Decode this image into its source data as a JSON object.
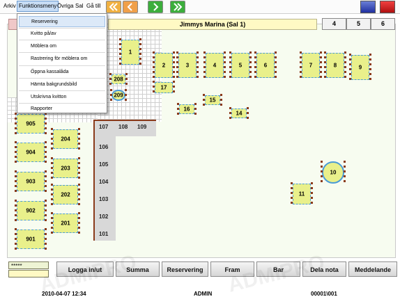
{
  "menubar": {
    "items": [
      "Arkiv",
      "Funktionsmeny",
      "Övriga",
      "Sal",
      "Gå till"
    ]
  },
  "nav": {
    "buttons": [
      "double-left-arrow-icon",
      "left-arrow-icon",
      "right-arrow-icon",
      "double-right-arrow-icon"
    ],
    "colors": [
      "#f0b040",
      "#f0a04a",
      "#3cae3c",
      "#3cae3c"
    ]
  },
  "window": {
    "buttons": [
      "blue-square-icon",
      "red-square-icon"
    ]
  },
  "dropdown": {
    "items": [
      "Reservering",
      "Kvitto på/av",
      "Möblera om",
      "Rastrering för möblera om",
      "Öppna kassalåda",
      "Hämta bakgrundsbild",
      "Utskrivna kvitton",
      "Rapporter"
    ]
  },
  "header": {
    "title": "Jimmys Marina (Sal 1)",
    "pages": [
      "4",
      "5",
      "6"
    ]
  },
  "floor": {
    "tables": [
      "1",
      "2",
      "3",
      "4",
      "5",
      "6",
      "7",
      "8",
      "9",
      "10",
      "11",
      "14",
      "15",
      "16",
      "17",
      "208",
      "209",
      "905",
      "904",
      "903",
      "902",
      "901",
      "204",
      "203",
      "202",
      "201"
    ],
    "rooms": [
      "107",
      "108",
      "109",
      "106",
      "105",
      "104",
      "103",
      "102",
      "101"
    ]
  },
  "login": {
    "masked": "*****"
  },
  "buttons": {
    "login": "Logga in/ut",
    "sum": "Summa",
    "reservation": "Reservering",
    "forward": "Fram",
    "bar": "Bar",
    "split": "Dela nota",
    "message": "Meddelande"
  },
  "status": {
    "datetime": "2010-04-07 12:34",
    "user": "ADMIN",
    "id": "00001\\001"
  },
  "watermark": "ADMIPRO"
}
